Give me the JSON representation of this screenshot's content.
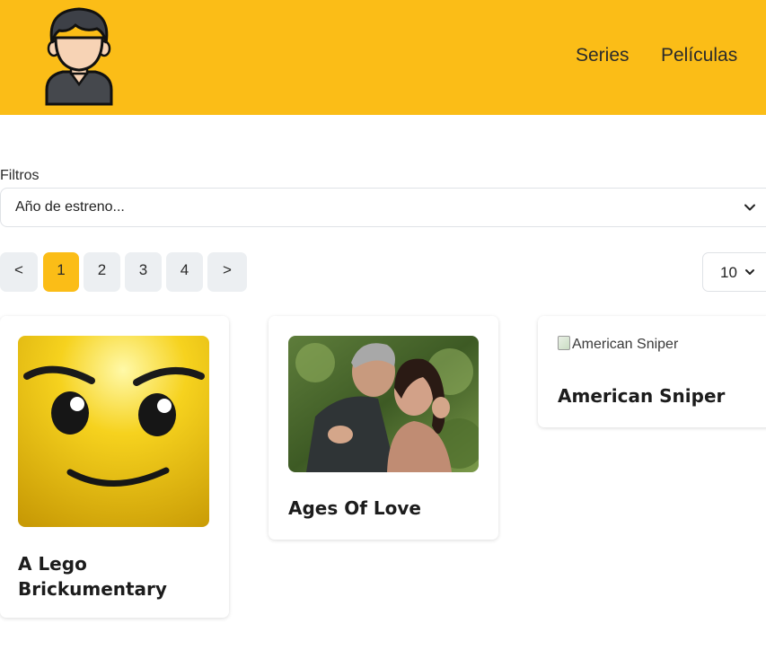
{
  "header": {
    "nav": {
      "series": "Series",
      "peliculas": "Películas"
    }
  },
  "filters": {
    "label": "Filtros",
    "year_select": {
      "selected": "Año de estreno..."
    }
  },
  "pagination": {
    "prev": "<",
    "next": ">",
    "pages": [
      "1",
      "2",
      "3",
      "4"
    ],
    "current_page": "1",
    "per_page": "10"
  },
  "cards": [
    {
      "title_line1": "A Lego",
      "title_line2": "Brickumentary"
    },
    {
      "title": "Ages Of Love"
    },
    {
      "title": "American Sniper",
      "image_alt": "American Sniper"
    }
  ],
  "colors": {
    "accent": "#fbbd17",
    "page_button_bg": "#eceff2"
  }
}
